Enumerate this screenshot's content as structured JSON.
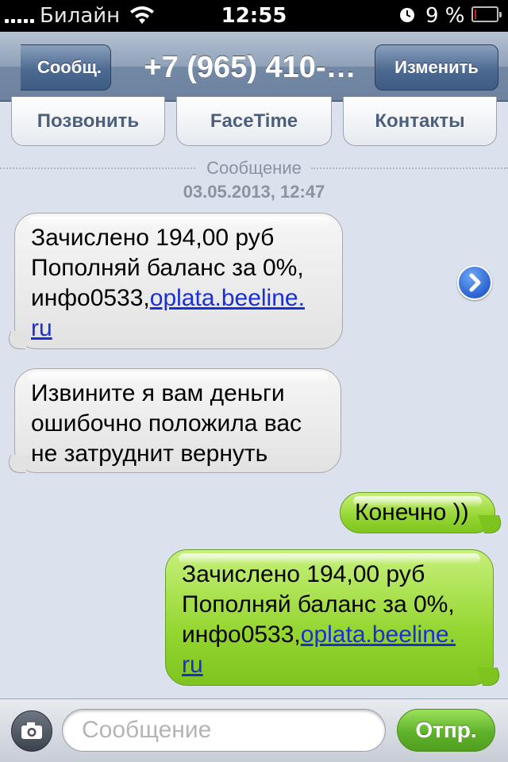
{
  "status_bar": {
    "carrier": "Билайн",
    "time": "12:55",
    "battery_percent_label": "9 %",
    "battery_level": 0.09,
    "icons": [
      "signal-dots-icon",
      "wifi-icon",
      "alarm-icon",
      "battery-icon"
    ],
    "battery_color": "#e01a1a"
  },
  "nav": {
    "back_label": "Сообщ.",
    "title": "+7 (965) 410-…",
    "edit_label": "Изменить"
  },
  "actions": {
    "call_label": "Позвонить",
    "facetime_label": "FaceTime",
    "contacts_label": "Контакты"
  },
  "thread": {
    "section_label": "Сообщение",
    "timestamp": "03.05.2013, 12:47",
    "messages": [
      {
        "direction": "incoming",
        "line1": "Зачислено 194,00 руб",
        "line2": "Пополняй баланс за 0%,",
        "line3_text": "инфо0533,",
        "link_part1": "oplata.beeline.",
        "link_part2": "ru"
      },
      {
        "direction": "incoming",
        "line1": "Извините я вам деньги",
        "line2": "ошибочно положила вас",
        "line3": "не затруднит вернуть"
      },
      {
        "direction": "outgoing",
        "line1": "Конечно ))"
      },
      {
        "direction": "outgoing",
        "line1": "Зачислено 194,00 руб",
        "line2": "Пополняй баланс за 0%,",
        "line3_text": "инфо0533,",
        "link_part1": "oplata.beeline.",
        "link_part2": "ru"
      }
    ],
    "forward_icon": "chevron-right-circle-icon"
  },
  "composer": {
    "placeholder": "Сообщение",
    "value": "",
    "send_label": "Отпр.",
    "camera_icon": "camera-icon"
  },
  "colors": {
    "background": "#dbe2ed",
    "incoming_bubble": "#e6e6e6",
    "outgoing_bubble": "#95d631",
    "link": "#1a2fd8",
    "nav_bar": "#6d829f"
  }
}
